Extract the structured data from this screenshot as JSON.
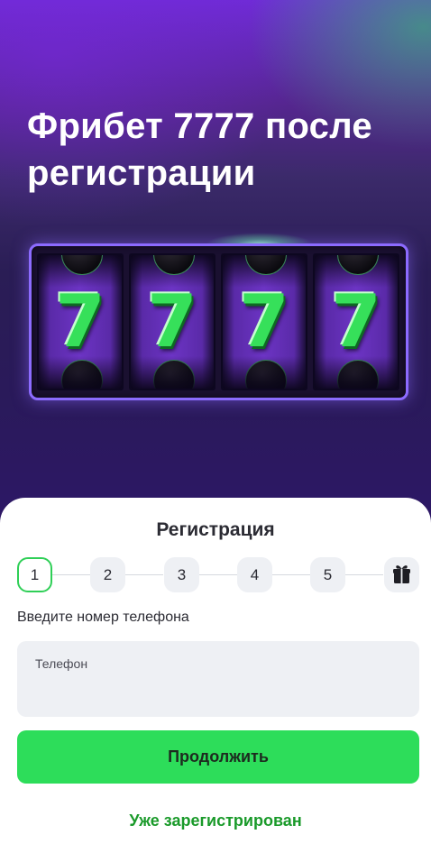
{
  "hero": {
    "title": "Фрибет 7777 после регистрации",
    "reels": [
      {
        "symbol": "7"
      },
      {
        "symbol": "7"
      },
      {
        "symbol": "7"
      },
      {
        "symbol": "7"
      }
    ]
  },
  "registration": {
    "title": "Регистрация",
    "steps": [
      "1",
      "2",
      "3",
      "4",
      "5"
    ],
    "active_step": "1",
    "final_step_icon": "gift-icon",
    "hint": "Введите номер телефона",
    "phone_label": "Телефон",
    "continue_label": "Продолжить",
    "already_registered_label": "Уже зарегистрирован"
  },
  "colors": {
    "accent_green": "#2ddd5a",
    "link_green": "#1a9a2a",
    "hero_purple": "#6f2bd6"
  }
}
